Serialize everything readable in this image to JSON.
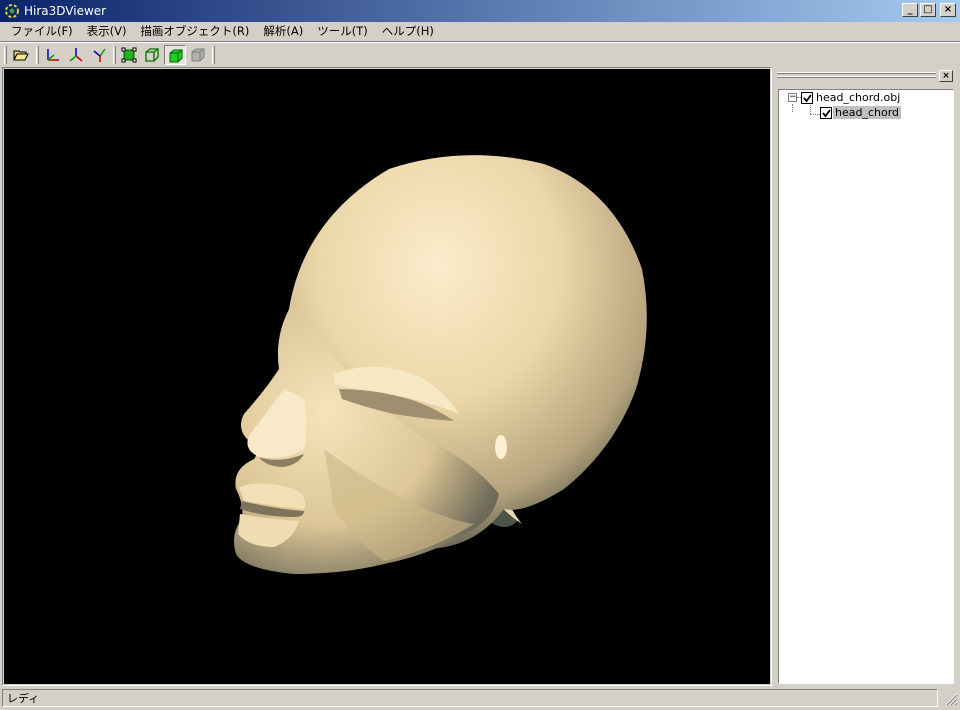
{
  "window": {
    "title": "Hira3DViewer",
    "icon": "app-logo-icon",
    "controls": {
      "minimize": "_",
      "maximize": "□",
      "close": "×"
    }
  },
  "menubar": {
    "items": [
      {
        "label": "ファイル(F)"
      },
      {
        "label": "表示(V)"
      },
      {
        "label": "描画オブジェクト(R)"
      },
      {
        "label": "解析(A)"
      },
      {
        "label": "ツール(T)"
      },
      {
        "label": "ヘルプ(H)"
      }
    ]
  },
  "toolbar": {
    "buttons": [
      {
        "icon": "open-folder-icon"
      },
      {
        "icon": "view-xy-axes-icon"
      },
      {
        "icon": "view-yz-axes-icon"
      },
      {
        "icon": "view-zx-axes-icon"
      },
      {
        "icon": "fit-view-icon"
      },
      {
        "icon": "wireframe-icon"
      },
      {
        "icon": "solid-shading-icon",
        "pressed": true
      },
      {
        "icon": "hidden-line-icon",
        "disabled": true
      }
    ]
  },
  "viewport": {
    "background": "#000000",
    "model_color": "#ecd9ae",
    "model": "3D head mesh rendering"
  },
  "object_tree": {
    "close_label": "×",
    "nodes": [
      {
        "label": "head_chord.obj",
        "checked": true,
        "expanded": true,
        "expander": "−"
      },
      {
        "label": "head_chord",
        "checked": true,
        "selected": true
      }
    ]
  },
  "statusbar": {
    "text": "レディ"
  },
  "colors": {
    "title_gradient_start": "#0a246a",
    "title_gradient_end": "#a6caf0",
    "face": "#d4d0c8"
  }
}
